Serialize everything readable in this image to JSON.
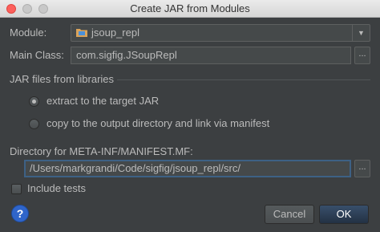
{
  "window": {
    "title": "Create JAR from Modules"
  },
  "module": {
    "label": "Module:",
    "value": "jsoup_repl"
  },
  "main_class": {
    "label": "Main Class:",
    "value": "com.sigfig.JSoupRepl"
  },
  "jar_section": {
    "title": "JAR files from libraries",
    "option_extract": "extract to the target JAR",
    "option_copy": "copy to the output directory and link via manifest",
    "selected": "extract"
  },
  "manifest": {
    "label": "Directory for META-INF/MANIFEST.MF:",
    "value": "/Users/markgrandi/Code/sigfig/jsoup_repl/src/"
  },
  "include_tests": {
    "label": "Include tests",
    "checked": false
  },
  "buttons": {
    "help": "?",
    "cancel": "Cancel",
    "ok": "OK",
    "browse": "..."
  },
  "colors": {
    "background": "#3c3f41",
    "accent": "#2f65ca",
    "focus_border": "#3d6185"
  }
}
